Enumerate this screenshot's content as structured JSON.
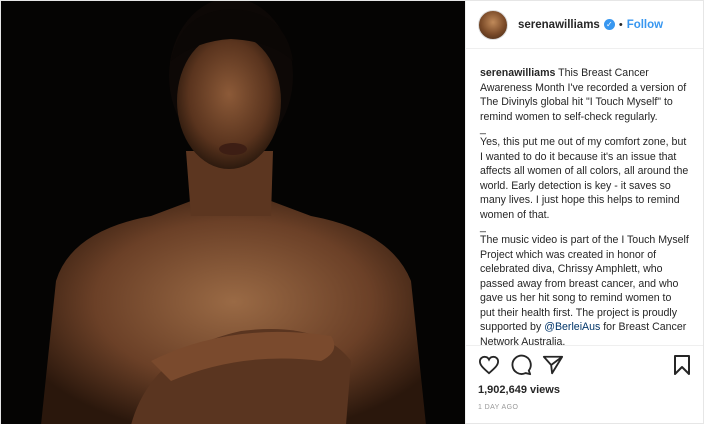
{
  "post": {
    "media_alt": "video frame",
    "header": {
      "username": "serenawilliams",
      "verified_icon": "verified-badge-icon",
      "separator": "•",
      "follow_label": "Follow"
    },
    "caption": {
      "username": "serenawilliams",
      "para1": " This Breast Cancer Awareness Month I've recorded a version of The Divinyls global hit \"I Touch Myself\" to remind women to self-check regularly.",
      "sep1": "_",
      "para2": "Yes, this put me out of my comfort zone, but I wanted to do it because it's an issue that affects all women of all colors, all around the world. Early detection is key - it saves so many lives. I just hope this helps to remind women of that.",
      "sep2": "_",
      "para3_before": "The music video is part of the I Touch Myself Project which was created in honor of celebrated diva, Chrissy Amphlett, who passed away from breast cancer, and who gave us her hit song to remind women to put their health first. The project is proudly supported by ",
      "mention": "@BerleiAus",
      "para3_after": " for Breast Cancer Network Australia."
    },
    "actions": {
      "like_icon": "heart-icon",
      "comment_icon": "comment-icon",
      "share_icon": "share-icon",
      "save_icon": "bookmark-icon"
    },
    "views": "1,902,649 views",
    "timestamp": "1 DAY AGO"
  },
  "colors": {
    "accent": "#3897f0",
    "mention": "#003569",
    "media_bg": "#000000",
    "muted": "#999999"
  }
}
